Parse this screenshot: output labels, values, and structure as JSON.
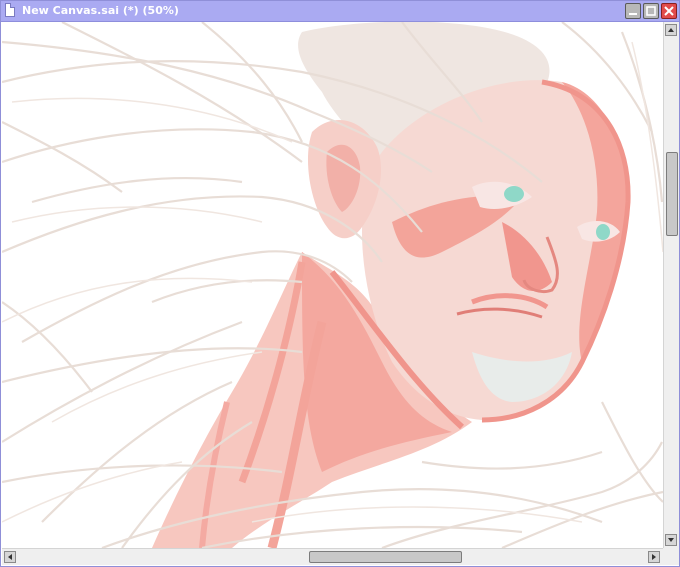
{
  "window": {
    "title": "New Canvas.sai (*) (50%)",
    "icon": "document-icon",
    "controls": [
      "minimize-icon",
      "maximize-icon",
      "close-icon"
    ]
  },
  "colors": {
    "titlebar": "#aaaaf2",
    "close_button": "#e24b4b",
    "sketch_lines": "#e8ddd6",
    "skin_shadow": "#f4a098",
    "skin_light": "#f6dcd6",
    "eye": "#8fd8c8"
  },
  "canvas": {
    "content": "digital painting sketch of a face in profile"
  }
}
